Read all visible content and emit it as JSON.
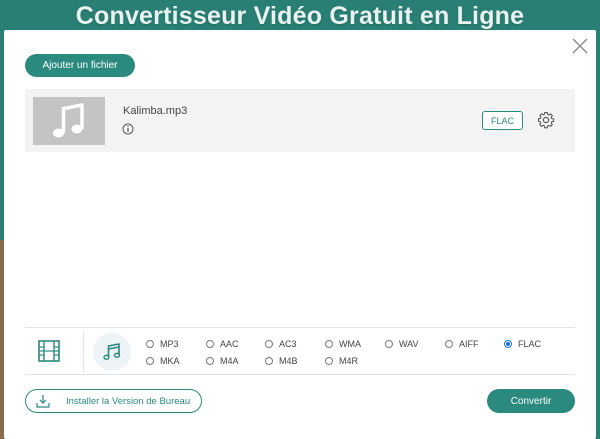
{
  "background": {
    "title": "Convertisseur Vidéo Gratuit en Ligne"
  },
  "modal": {
    "add_file_label": "Ajouter un fichier",
    "file": {
      "name": "Kalimba.mp3",
      "format": "FLAC"
    },
    "audio_formats": [
      {
        "label": "MP3",
        "checked": false
      },
      {
        "label": "AAC",
        "checked": false
      },
      {
        "label": "AC3",
        "checked": false
      },
      {
        "label": "WMA",
        "checked": false
      },
      {
        "label": "WAV",
        "checked": false
      },
      {
        "label": "AIFF",
        "checked": false
      },
      {
        "label": "FLAC",
        "checked": true
      },
      {
        "label": "MKA",
        "checked": false
      },
      {
        "label": "M4A",
        "checked": false
      },
      {
        "label": "M4B",
        "checked": false
      },
      {
        "label": "M4R",
        "checked": false
      }
    ],
    "install_label": "Installer la Version de Bureau",
    "convert_label": "Convertir"
  },
  "colors": {
    "accent": "#2b8a7e",
    "background": "#2a7f74",
    "radio_selected": "#1a73e8"
  },
  "icons": [
    "close-icon",
    "music-note-icon",
    "info-icon",
    "gear-icon",
    "film-icon",
    "audio-note-icon",
    "download-icon"
  ]
}
